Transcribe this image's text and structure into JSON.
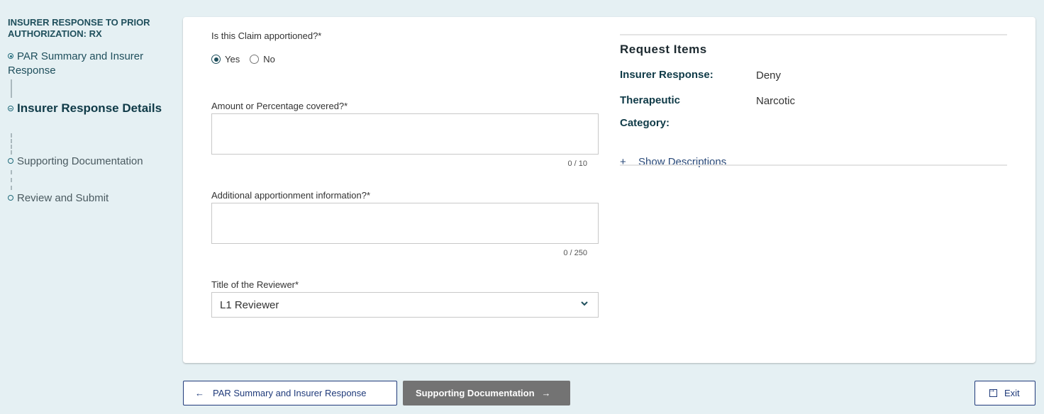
{
  "sidebar": {
    "title": "INSURER RESPONSE TO PRIOR AUTHORIZATION: RX",
    "steps": [
      {
        "label": "PAR Summary and Insurer Response",
        "state": "completed"
      },
      {
        "label": "Insurer Response Details",
        "state": "current"
      },
      {
        "label": "Supporting Documentation",
        "state": "pending"
      },
      {
        "label": "Review and Submit",
        "state": "pending"
      }
    ]
  },
  "form": {
    "apportioned": {
      "label": "Is this Claim apportioned?*",
      "options": [
        "Yes",
        "No"
      ],
      "selected": "Yes"
    },
    "amount": {
      "label": "Amount or Percentage covered?*",
      "value": "",
      "counter": "0 / 10"
    },
    "additional": {
      "label": "Additional apportionment information?*",
      "value": "",
      "counter": "0 / 250"
    },
    "reviewer_title": {
      "label": "Title of the Reviewer*",
      "selected": "L1 Reviewer"
    }
  },
  "request_items": {
    "title": "Request Items",
    "rows": [
      {
        "key": "Insurer Response:",
        "value": "Deny"
      },
      {
        "key": "Therapeutic Category:",
        "key_line1": "Therapeutic",
        "key_line2": "Category:",
        "value": "Narcotic"
      }
    ],
    "show_descriptions": "Show Descriptions",
    "show_descriptions_icon": "+"
  },
  "footer": {
    "back_label": "PAR Summary and Insurer Response",
    "next_label": "Supporting Documentation",
    "exit_label": "Exit",
    "back_icon": "←",
    "next_icon": "→"
  }
}
